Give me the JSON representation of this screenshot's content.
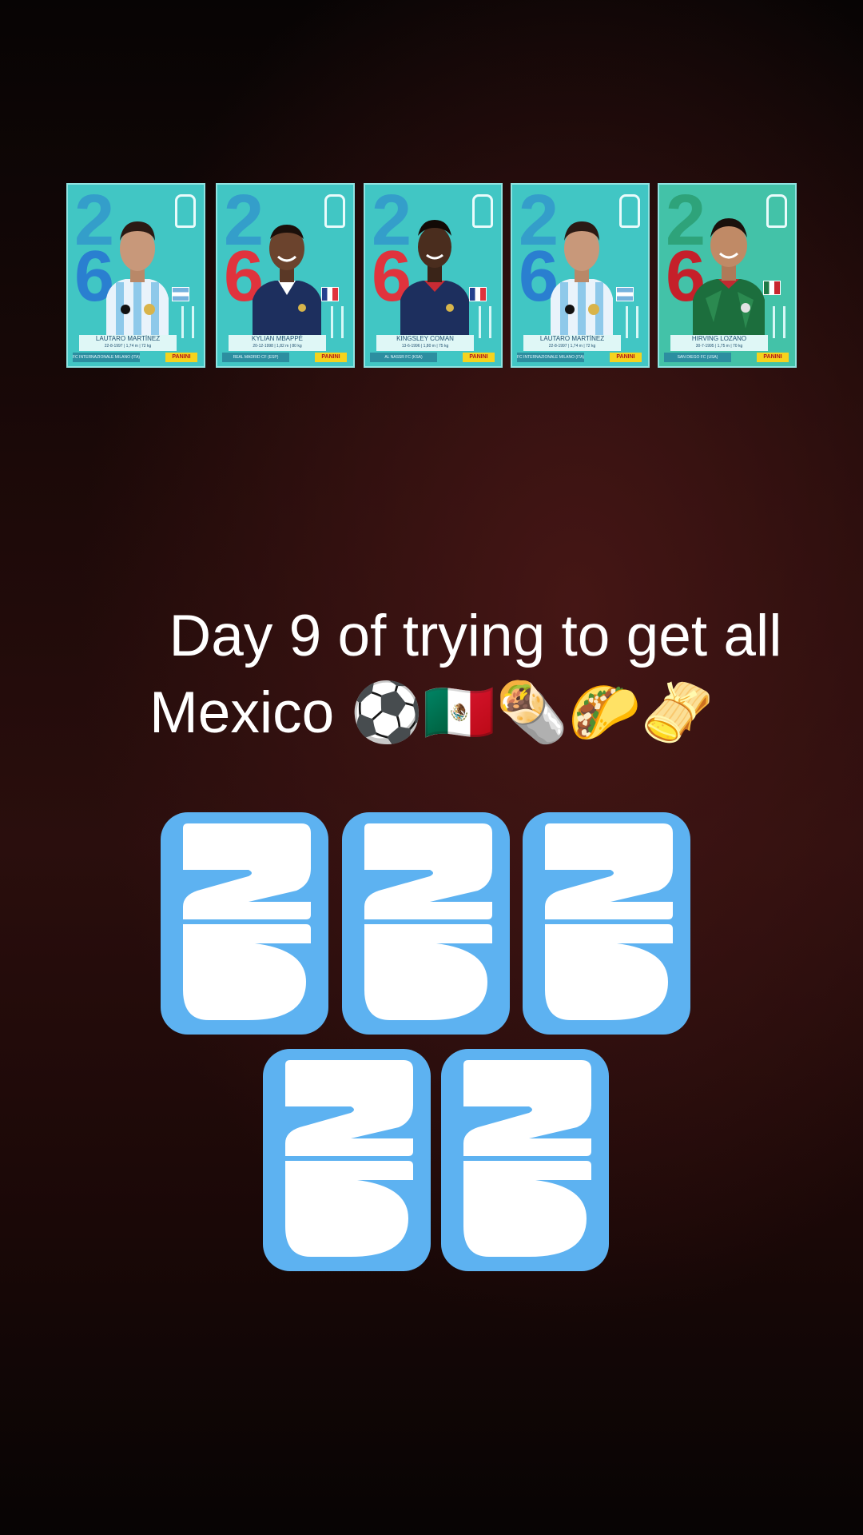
{
  "stickers": [
    {
      "name": "LAUTARO MARTÍNEZ",
      "meta": "22-8-1997 | 1,74 m | 72 kg",
      "club": "FC INTERNAZIONALE MILANO (ITA)",
      "brand": "PANINI",
      "numbers": [
        "2",
        "6"
      ],
      "variant": "argentina"
    },
    {
      "name": "KYLIAN MBAPPÉ",
      "meta": "20-12-1998 | 1,82 m | 80 kg",
      "club": "REAL MADRID CF (ESP)",
      "brand": "PANINI",
      "numbers": [
        "2",
        "6"
      ],
      "variant": "france"
    },
    {
      "name": "KINGSLEY COMAN",
      "meta": "13-6-1996 | 1,80 m | 75 kg",
      "club": "AL NASSR FC (KSA)",
      "brand": "PANINI",
      "numbers": [
        "2",
        "6"
      ],
      "variant": "france"
    },
    {
      "name": "LAUTARO MARTÍNEZ",
      "meta": "22-8-1997 | 1,74 m | 72 kg",
      "club": "FC INTERNAZIONALE MILANO (ITA)",
      "brand": "PANINI",
      "numbers": [
        "2",
        "6"
      ],
      "variant": "argentina"
    },
    {
      "name": "HIRVING LOZANO",
      "meta": "30-7-1995 | 1,75 m | 70 kg",
      "club": "SAN DIEGO FC (USA)",
      "brand": "PANINI",
      "numbers": [
        "2",
        "6"
      ],
      "variant": "mexico"
    }
  ],
  "caption": {
    "line1": "Day 9 of trying to get all",
    "line2": "Mexico ⚽🇲🇽🌯🌮🫔"
  },
  "packs_count_visible": 5,
  "colors": {
    "sticker_bg": "#41c6c4",
    "pack_blue": "#5db2f1",
    "background_dark": "#1b0908"
  }
}
